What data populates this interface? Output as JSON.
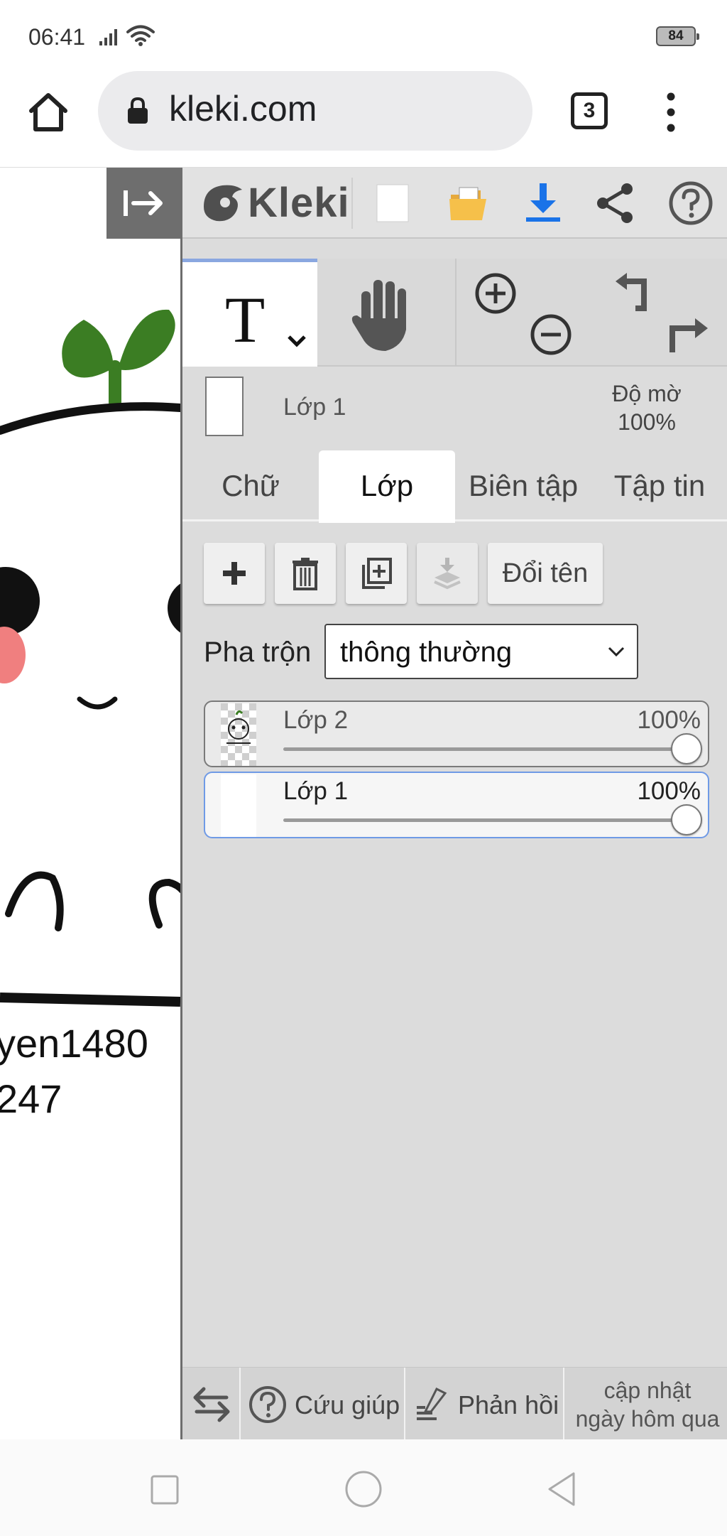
{
  "status_bar": {
    "time": "06:41",
    "battery": "84"
  },
  "browser": {
    "url": "kleki.com",
    "tab_count": "3"
  },
  "canvas": {
    "text_line_1": "yen1480",
    "text_line_2": "247"
  },
  "app": {
    "logo_text": "Kleki",
    "accent_color": "#1a73e8"
  },
  "layer_info": {
    "name": "Lớp 1",
    "opacity_label": "Độ mờ",
    "opacity_value": "100%"
  },
  "tabs": [
    {
      "label": "Chữ"
    },
    {
      "label": "Lớp"
    },
    {
      "label": "Biên tập"
    },
    {
      "label": "Tập tin"
    }
  ],
  "layer_actions": {
    "rename_label": "Đổi tên"
  },
  "blend": {
    "label": "Pha trộn",
    "value": "thông thường"
  },
  "layers": [
    {
      "name": "Lớp 2",
      "opacity": "100%",
      "opacity_value": 1.0
    },
    {
      "name": "Lớp 1",
      "opacity": "100%",
      "opacity_value": 1.0
    }
  ],
  "bottom_bar": {
    "help_label": "Cứu giúp",
    "feedback_label": "Phản hồi",
    "update_line_1": "cập nhật",
    "update_line_2": "ngày hôm qua"
  }
}
